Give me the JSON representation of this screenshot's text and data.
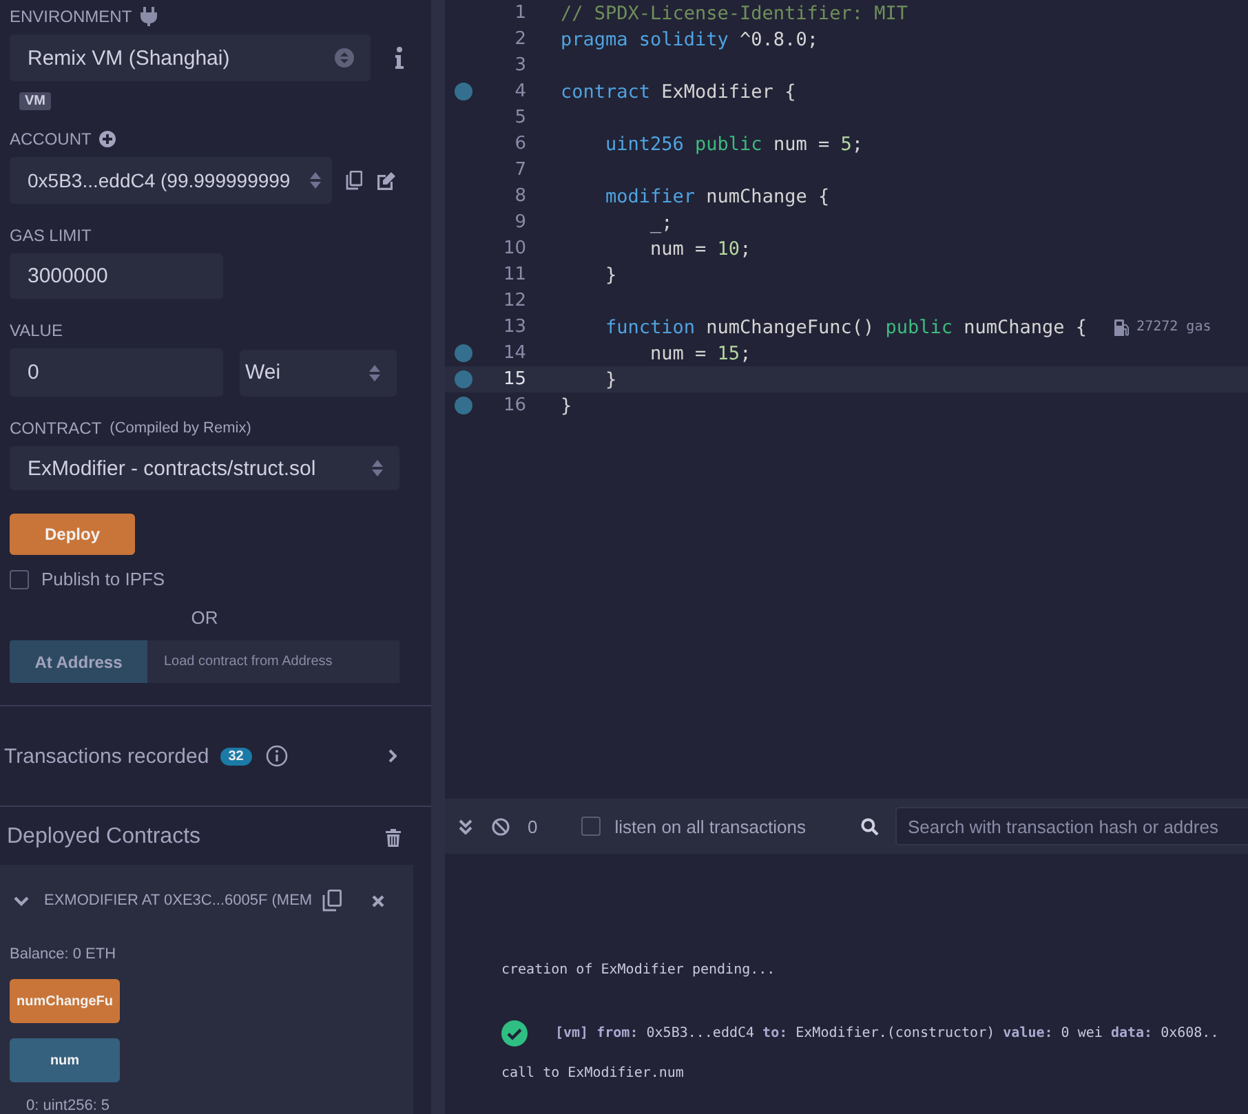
{
  "run_panel": {
    "environment": {
      "label": "ENVIRONMENT",
      "value": "Remix VM (Shanghai)",
      "badge": "VM"
    },
    "account": {
      "label": "ACCOUNT",
      "value": "0x5B3...eddC4 (99.999999999"
    },
    "gas_limit": {
      "label": "GAS LIMIT",
      "value": "3000000"
    },
    "value": {
      "label": "VALUE",
      "amount": "0",
      "unit": "Wei"
    },
    "contract": {
      "label": "CONTRACT",
      "note": "(Compiled by Remix)",
      "value": "ExModifier - contracts/struct.sol"
    },
    "deploy_button": "Deploy",
    "publish_ipfs": {
      "label": "Publish to IPFS",
      "checked": false
    },
    "or_text": "OR",
    "at_address": {
      "button": "At Address",
      "placeholder": "Load contract from Address"
    },
    "transactions": {
      "label": "Transactions recorded",
      "count": "32"
    },
    "deployed": {
      "title": "Deployed Contracts",
      "instance": {
        "name": "EXMODIFIER AT 0XE3C...6005F (MEM",
        "expanded": true,
        "balance": "Balance: 0 ETH",
        "functions": [
          {
            "label": "numChangeFu",
            "kind": "transact"
          },
          {
            "label": "num",
            "kind": "call"
          }
        ],
        "output": "0: uint256: 5"
      }
    }
  },
  "editor": {
    "lines": [
      {
        "number": "1",
        "breakpoint": false,
        "selected": false,
        "tokens": [
          {
            "text": "// SPDX-License-Identifier: MIT",
            "kind": "comment"
          }
        ]
      },
      {
        "number": "2",
        "breakpoint": false,
        "selected": false,
        "tokens": [
          {
            "text": "pragma solidity",
            "kind": "keyword"
          },
          {
            "text": " ^0.8.0;",
            "kind": "plain"
          }
        ]
      },
      {
        "number": "3",
        "breakpoint": false,
        "selected": false
      },
      {
        "number": "4",
        "breakpoint": true,
        "selected": false,
        "tokens": [
          {
            "text": "contract",
            "kind": "keyword"
          },
          {
            "text": " ExModifier {",
            "kind": "plain"
          }
        ]
      },
      {
        "number": "5",
        "breakpoint": false,
        "selected": false
      },
      {
        "number": "6",
        "breakpoint": false,
        "selected": false,
        "tokens": [
          {
            "text": "    uint256",
            "kind": "keyword"
          },
          {
            "text": " public",
            "kind": "visibility"
          },
          {
            "text": " num = ",
            "kind": "plain"
          },
          {
            "text": "5",
            "kind": "number"
          },
          {
            "text": ";",
            "kind": "plain"
          }
        ]
      },
      {
        "number": "7",
        "breakpoint": false,
        "selected": false
      },
      {
        "number": "8",
        "breakpoint": false,
        "selected": false,
        "tokens": [
          {
            "text": "    modifier",
            "kind": "keyword"
          },
          {
            "text": " numChange {",
            "kind": "plain"
          }
        ]
      },
      {
        "number": "9",
        "breakpoint": false,
        "selected": false,
        "tokens": [
          {
            "text": "        _;",
            "kind": "plain"
          }
        ]
      },
      {
        "number": "10",
        "breakpoint": false,
        "selected": false,
        "tokens": [
          {
            "text": "        num = ",
            "kind": "plain"
          },
          {
            "text": "10",
            "kind": "number"
          },
          {
            "text": ";",
            "kind": "plain"
          }
        ]
      },
      {
        "number": "11",
        "breakpoint": false,
        "selected": false,
        "tokens": [
          {
            "text": "    }",
            "kind": "plain"
          }
        ]
      },
      {
        "number": "12",
        "breakpoint": false,
        "selected": false
      },
      {
        "number": "13",
        "breakpoint": false,
        "selected": false,
        "gas": "27272 gas",
        "tokens": [
          {
            "text": "    function",
            "kind": "keyword"
          },
          {
            "text": " numChangeFunc() ",
            "kind": "plain"
          },
          {
            "text": "public",
            "kind": "visibility"
          },
          {
            "text": " numChange {",
            "kind": "plain"
          }
        ]
      },
      {
        "number": "14",
        "breakpoint": true,
        "selected": false,
        "tokens": [
          {
            "text": "        num = ",
            "kind": "plain"
          },
          {
            "text": "15",
            "kind": "number"
          },
          {
            "text": ";",
            "kind": "plain"
          }
        ]
      },
      {
        "number": "15",
        "breakpoint": true,
        "selected": true,
        "tokens": [
          {
            "text": "    }",
            "kind": "plain"
          }
        ]
      },
      {
        "number": "16",
        "breakpoint": true,
        "selected": false,
        "tokens": [
          {
            "text": "}",
            "kind": "plain"
          }
        ]
      }
    ]
  },
  "terminal": {
    "pending_count": "0",
    "listen": {
      "label": "listen on all transactions",
      "checked": false
    },
    "search": {
      "placeholder": "Search with transaction hash or addres"
    },
    "log": [
      {
        "kind": "text",
        "text": "creation of ExModifier pending..."
      },
      {
        "kind": "tx",
        "success": true,
        "text": "**[vm]** **from:** 0x5B3...eddC4 **to:** ExModifier.(constructor) **value:** 0 wei **data:** 0x608.."
      },
      {
        "kind": "text",
        "text": "call to ExModifier.num"
      }
    ]
  }
}
